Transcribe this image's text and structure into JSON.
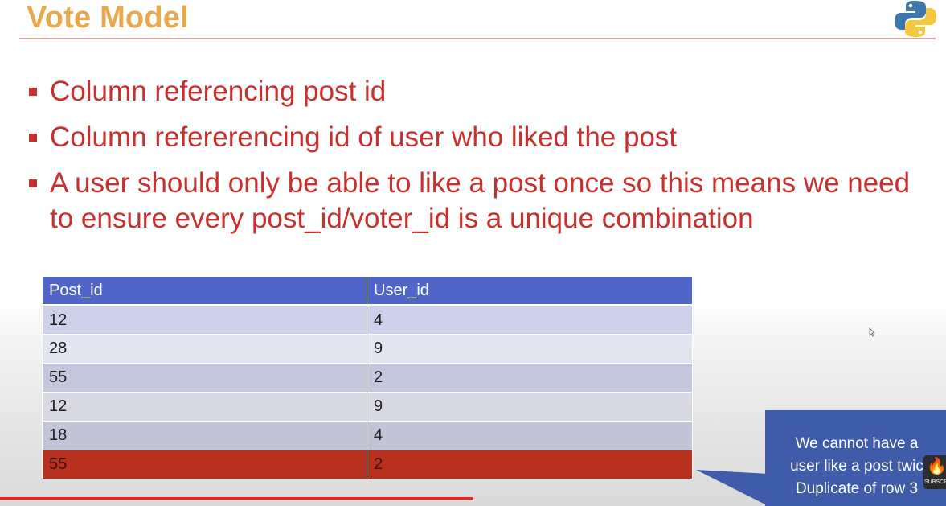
{
  "slide": {
    "title": "Vote Model",
    "logo_icon": "python-logo-icon",
    "bullets": [
      "Column referencing post id",
      "Column refererencing id of user who liked the post",
      "A user should only be able to like a post once so this means we need to ensure every post_id/voter_id is a unique combination"
    ]
  },
  "table": {
    "headers": [
      "Post_id",
      "User_id"
    ],
    "rows": [
      [
        "12",
        "4"
      ],
      [
        "28",
        "9"
      ],
      [
        "55",
        "2"
      ],
      [
        "12",
        "9"
      ],
      [
        "18",
        "4"
      ],
      [
        "55",
        "2"
      ]
    ],
    "highlight_color": "#b8311e",
    "header_color": "#4f65c8"
  },
  "callout": {
    "lines": [
      "We cannot have a",
      "user like a post twic",
      "Duplicate of row 3"
    ],
    "color": "#3f5cab"
  },
  "overlay": {
    "subscribe_label": "SUBSCR",
    "video_progress_percent": 50,
    "progress_color": "#ff1a1a"
  }
}
